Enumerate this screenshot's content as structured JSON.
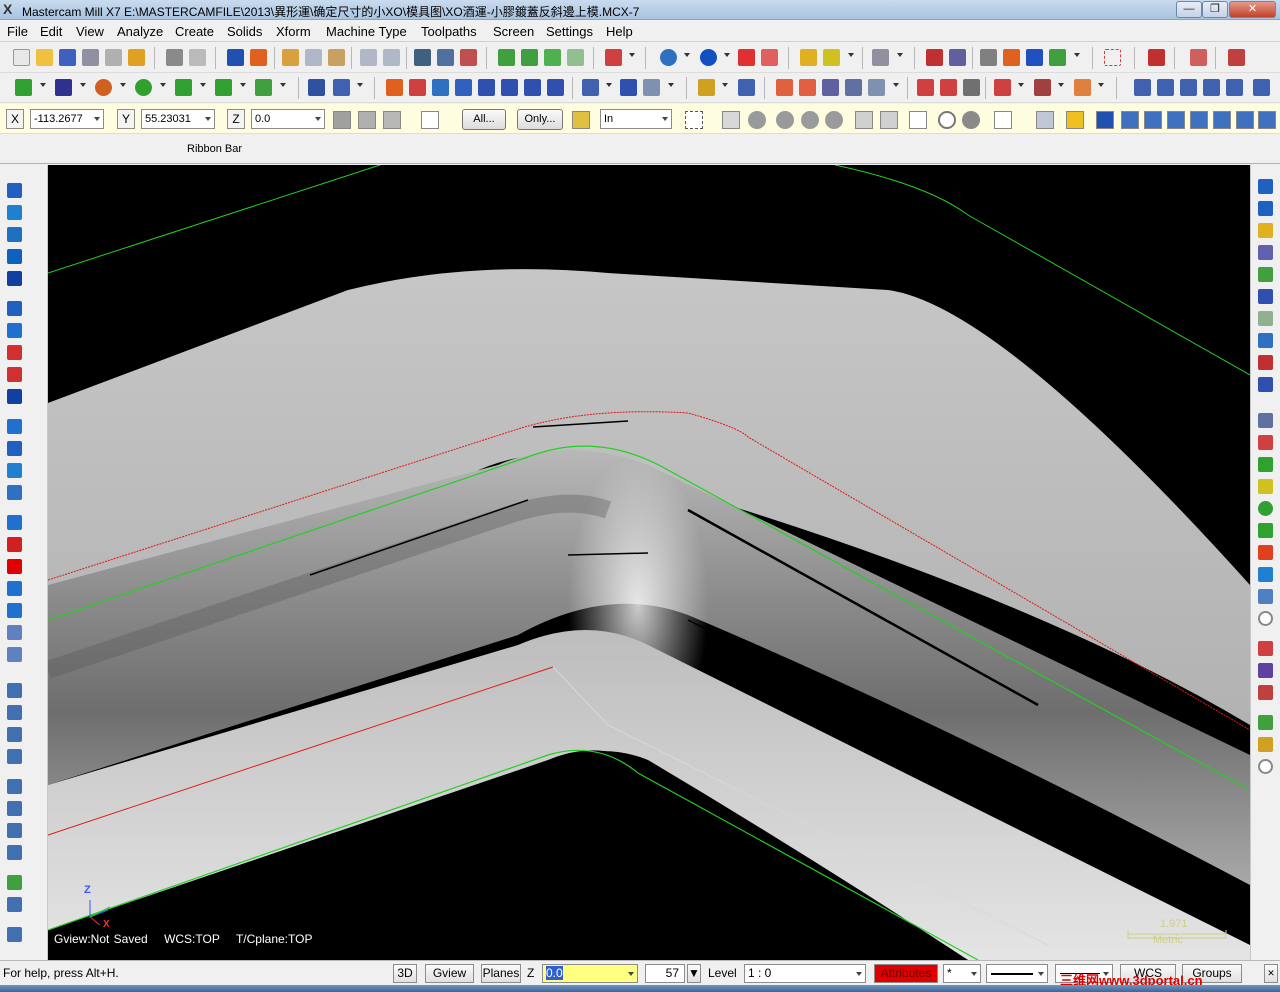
{
  "title": "Mastercam Mill X7  E:\\MASTERCAMFILE\\2013\\異形運\\确定尺寸的小XO\\模具图\\XO酒運-小膠鍍蓋反斜邊上模.MCX-7",
  "window_buttons": {
    "minimize": "—",
    "maximize": "❐",
    "close": "✕"
  },
  "menu": [
    {
      "label": "File"
    },
    {
      "label": "Edit"
    },
    {
      "label": "View"
    },
    {
      "label": "Analyze"
    },
    {
      "label": "Create"
    },
    {
      "label": "Solids"
    },
    {
      "label": "Xform"
    },
    {
      "label": "Machine Type"
    },
    {
      "label": "Toolpaths"
    },
    {
      "label": "Screen"
    },
    {
      "label": "Settings"
    },
    {
      "label": "Help"
    }
  ],
  "ribbon": {
    "x_label": "X",
    "x_value": "-113.2677",
    "y_label": "Y",
    "y_value": "55.23031",
    "z_label": "Z",
    "z_value": "0.0",
    "all_button": "All...",
    "only_button": "Only...",
    "units_select": "In",
    "caption": "Ribbon Bar"
  },
  "viewport": {
    "gview": "Gview:Not Saved",
    "wcs": "WCS:TOP",
    "tcplane": "T/Cplane:TOP",
    "scale_value": "1.971",
    "scale_unit": "Metric",
    "axis_z": "Z",
    "axis_x": "X"
  },
  "statusbar": {
    "help": "For help, press Alt+H.",
    "btn_3d": "3D",
    "btn_gview": "Gview",
    "btn_planes": "Planes",
    "z_label": "Z",
    "z_value": "0.0",
    "color_value": "57",
    "level_label": "Level",
    "level_value": "1 : 0",
    "attributes": "Attributes",
    "wcs": "WCS",
    "groups": "Groups",
    "watermark": "三维网www.3dportal.cn"
  },
  "colors": {
    "accent_red": "#e00000",
    "highlight_yellow": "#ffff80",
    "geometry_green": "#22d022",
    "geometry_red": "#e01818",
    "background": "#000000"
  }
}
